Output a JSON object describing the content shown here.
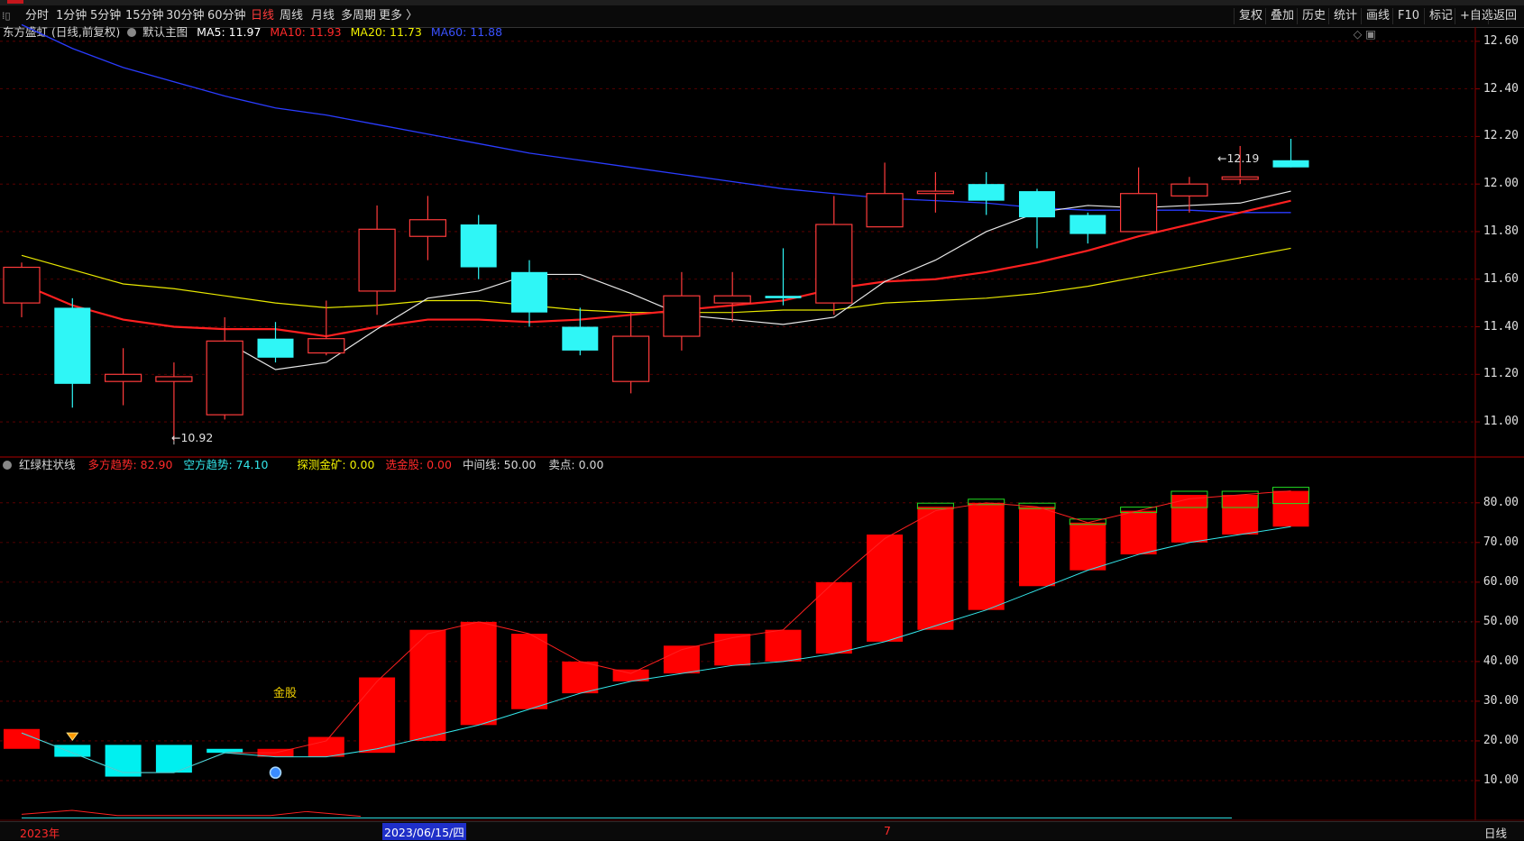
{
  "toolbar": {
    "left_icon": "⁞▯",
    "periods": [
      "分时",
      "1分钟",
      "5分钟",
      "15分钟",
      "30分钟",
      "60分钟",
      "日线",
      "周线",
      "月线",
      "多周期",
      "更多 〉"
    ],
    "active": "日线",
    "right_tools": [
      "复权",
      "叠加",
      "历史",
      "统计",
      "画线",
      "F10",
      "标记",
      "+自选",
      "返回"
    ]
  },
  "main_legend": {
    "stock": "东方盛虹 (日线,前复权)",
    "template": "默认主图",
    "ma5": "MA5: 11.97",
    "ma10": "MA10: 11.93",
    "ma20": "MA20: 11.73",
    "ma60": "MA60: 11.88",
    "colors": {
      "ma5": "#ffffff",
      "ma10": "#ff2a2a",
      "ma20": "#f0f000",
      "ma60": "#3a52ff"
    }
  },
  "indicator_legend": {
    "name": "红绿柱状线",
    "bull": "多方趋势: 82.90",
    "bear": "空方趋势: 74.10",
    "probe": "探测金矿: 0.00",
    "select": "选金股: 0.00",
    "mid": "中间线: 50.00",
    "sell": "卖点: 0.00",
    "signal_label": "金股"
  },
  "price_axis": [
    "12.60",
    "12.40",
    "12.20",
    "12.00",
    "11.80",
    "11.60",
    "11.40",
    "11.20",
    "11.00"
  ],
  "ind_axis": [
    "80.00",
    "70.00",
    "60.00",
    "50.00",
    "40.00",
    "30.00",
    "20.00",
    "10.00"
  ],
  "annotations": {
    "high": "12.19",
    "low": "10.92"
  },
  "bottom": {
    "year": "2023年",
    "date": "2023/06/15/四",
    "month": "7",
    "period": "日线"
  },
  "chart_data": {
    "type": "candlestick",
    "candles": [
      {
        "o": 11.5,
        "c": 11.65,
        "h": 11.67,
        "l": 11.44
      },
      {
        "o": 11.48,
        "c": 11.16,
        "h": 11.52,
        "l": 11.06
      },
      {
        "o": 11.17,
        "c": 11.2,
        "h": 11.31,
        "l": 11.07
      },
      {
        "o": 11.17,
        "c": 11.19,
        "h": 11.25,
        "l": 10.92
      },
      {
        "o": 11.03,
        "c": 11.34,
        "h": 11.44,
        "l": 11.01
      },
      {
        "o": 11.35,
        "c": 11.27,
        "h": 11.42,
        "l": 11.25
      },
      {
        "o": 11.29,
        "c": 11.35,
        "h": 11.51,
        "l": 11.28
      },
      {
        "o": 11.55,
        "c": 11.81,
        "h": 11.91,
        "l": 11.45
      },
      {
        "o": 11.78,
        "c": 11.85,
        "h": 11.95,
        "l": 11.68
      },
      {
        "o": 11.83,
        "c": 11.65,
        "h": 11.87,
        "l": 11.6
      },
      {
        "o": 11.63,
        "c": 11.46,
        "h": 11.68,
        "l": 11.4
      },
      {
        "o": 11.4,
        "c": 11.3,
        "h": 11.48,
        "l": 11.28
      },
      {
        "o": 11.17,
        "c": 11.36,
        "h": 11.46,
        "l": 11.12
      },
      {
        "o": 11.36,
        "c": 11.53,
        "h": 11.63,
        "l": 11.3
      },
      {
        "o": 11.5,
        "c": 11.53,
        "h": 11.63,
        "l": 11.42
      },
      {
        "o": 11.53,
        "c": 11.52,
        "h": 11.73,
        "l": 11.49
      },
      {
        "o": 11.5,
        "c": 11.83,
        "h": 11.95,
        "l": 11.45
      },
      {
        "o": 11.82,
        "c": 11.96,
        "h": 12.09,
        "l": 11.82
      },
      {
        "o": 11.96,
        "c": 11.97,
        "h": 12.05,
        "l": 11.88
      },
      {
        "o": 12.0,
        "c": 11.93,
        "h": 12.05,
        "l": 11.87
      },
      {
        "o": 11.97,
        "c": 11.86,
        "h": 11.98,
        "l": 11.73
      },
      {
        "o": 11.87,
        "c": 11.79,
        "h": 11.88,
        "l": 11.75
      },
      {
        "o": 11.8,
        "c": 11.96,
        "h": 12.07,
        "l": 11.8
      },
      {
        "o": 11.95,
        "c": 12.0,
        "h": 12.03,
        "l": 11.88
      },
      {
        "o": 12.02,
        "c": 12.03,
        "h": 12.16,
        "l": 12.0
      },
      {
        "o": 12.1,
        "c": 12.07,
        "h": 12.19,
        "l": 12.07
      }
    ],
    "ma5": [
      null,
      null,
      null,
      null,
      11.34,
      11.22,
      11.25,
      11.39,
      11.52,
      11.55,
      11.62,
      11.62,
      11.54,
      11.45,
      11.43,
      11.41,
      11.44,
      11.59,
      11.68,
      11.8,
      11.88,
      11.91,
      11.9,
      11.91,
      11.92,
      11.97
    ],
    "ma10": [
      11.58,
      11.49,
      11.43,
      11.4,
      11.39,
      11.39,
      11.36,
      11.4,
      11.43,
      11.43,
      11.42,
      11.43,
      11.45,
      11.47,
      11.49,
      11.51,
      11.56,
      11.59,
      11.6,
      11.63,
      11.67,
      11.72,
      11.78,
      11.83,
      11.88,
      11.93
    ],
    "ma20": [
      11.7,
      11.64,
      11.58,
      11.56,
      11.53,
      11.5,
      11.48,
      11.49,
      11.51,
      11.51,
      11.49,
      11.47,
      11.46,
      11.46,
      11.46,
      11.47,
      11.47,
      11.5,
      11.51,
      11.52,
      11.54,
      11.57,
      11.61,
      11.65,
      11.69,
      11.73
    ],
    "ma60": [
      12.67,
      12.57,
      12.49,
      12.43,
      12.37,
      12.32,
      12.29,
      12.25,
      12.21,
      12.17,
      12.13,
      12.1,
      12.07,
      12.04,
      12.01,
      11.98,
      11.96,
      11.94,
      11.93,
      11.92,
      11.9,
      11.89,
      11.89,
      11.89,
      11.88,
      11.88
    ],
    "ind_bars": [
      {
        "a": 23,
        "b": 18,
        "up": true
      },
      {
        "a": 19,
        "b": 16,
        "up": false
      },
      {
        "a": 19,
        "b": 11,
        "up": false
      },
      {
        "a": 19,
        "b": 12,
        "up": false
      },
      {
        "a": 18,
        "b": 17,
        "up": false
      },
      {
        "a": 16,
        "b": 18,
        "up": true
      },
      {
        "a": 16,
        "b": 21,
        "up": true
      },
      {
        "a": 17,
        "b": 36,
        "up": true
      },
      {
        "a": 20,
        "b": 48,
        "up": true
      },
      {
        "a": 24,
        "b": 50,
        "up": true
      },
      {
        "a": 28,
        "b": 47,
        "up": true
      },
      {
        "a": 32,
        "b": 40,
        "up": true
      },
      {
        "a": 35,
        "b": 38,
        "up": true
      },
      {
        "a": 37,
        "b": 44,
        "up": true
      },
      {
        "a": 39,
        "b": 47,
        "up": true
      },
      {
        "a": 40,
        "b": 48,
        "up": true
      },
      {
        "a": 42,
        "b": 60,
        "up": true
      },
      {
        "a": 45,
        "b": 72,
        "up": true
      },
      {
        "a": 48,
        "b": 79,
        "up": true
      },
      {
        "a": 53,
        "b": 80,
        "up": true
      },
      {
        "a": 59,
        "b": 79,
        "up": true
      },
      {
        "a": 63,
        "b": 75,
        "up": true
      },
      {
        "a": 67,
        "b": 78,
        "up": true
      },
      {
        "a": 70,
        "b": 82,
        "up": true
      },
      {
        "a": 72,
        "b": 82,
        "up": true
      },
      {
        "a": 74,
        "b": 83,
        "up": true
      }
    ],
    "bull_line": [
      22,
      17,
      12,
      12,
      17,
      17,
      20,
      35,
      47,
      50,
      47,
      40,
      37,
      43,
      46,
      48,
      60,
      71,
      78,
      80,
      79,
      75,
      78,
      81,
      82,
      83
    ],
    "bear_line": [
      22,
      17,
      12,
      12,
      17,
      16,
      16,
      18,
      21,
      24,
      28,
      32,
      35,
      37,
      39,
      40,
      42,
      45,
      49,
      53,
      58,
      63,
      67,
      70,
      72,
      74
    ],
    "green_marks": [
      18,
      19,
      20,
      21,
      22,
      23,
      24,
      25
    ],
    "price_range": [
      10.86,
      12.66
    ],
    "ind_range": [
      0,
      87
    ]
  }
}
